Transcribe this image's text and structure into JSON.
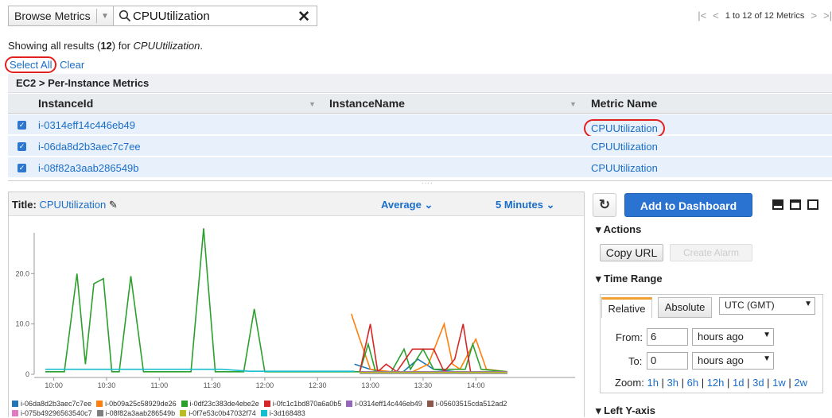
{
  "toolbar": {
    "browse_label": "Browse Metrics",
    "search_value": "CPUUtilization",
    "pager_text": "1 to 12 of 12 Metrics"
  },
  "results": {
    "prefix": "Showing all results (",
    "count": "12",
    "mid": ") for ",
    "query": "CPUUtilization",
    "suffix": ".",
    "select_all": "Select All",
    "clear": "Clear"
  },
  "table": {
    "group_title": "EC2 > Per-Instance Metrics",
    "columns": [
      "InstanceId",
      "InstanceName",
      "Metric Name"
    ],
    "rows": [
      {
        "instance_id": "i-0314eff14c446eb49",
        "metric": "CPUUtilization",
        "checked": true
      },
      {
        "instance_id": "i-06da8d2b3aec7c7ee",
        "metric": "CPUUtilization",
        "checked": true
      },
      {
        "instance_id": "i-08f82a3aab286549b",
        "metric": "CPUUtilization",
        "checked": true
      }
    ]
  },
  "graph": {
    "title_label": "Title:",
    "title_value": "CPUUtilization",
    "statistic": "Average",
    "period": "5 Minutes"
  },
  "chart_data": {
    "type": "line",
    "x": [
      "10:00",
      "10:30",
      "11:00",
      "11:30",
      "12:00",
      "12:30",
      "13:00",
      "13:30",
      "14:00"
    ],
    "ylim": [
      0,
      30
    ],
    "yticks": [
      "0",
      "10.0",
      "20.0"
    ],
    "series": [
      {
        "name": "i-06da8d2b3aec7c7ee",
        "color": "#1f77b4",
        "points": [
          [
            12.85,
            2
          ],
          [
            13.0,
            1
          ],
          [
            13.1,
            0.5
          ],
          [
            13.3,
            0.3
          ],
          [
            13.45,
            3
          ],
          [
            13.6,
            1
          ],
          [
            13.8,
            0.5
          ],
          [
            14.0,
            0.3
          ],
          [
            14.3,
            0.3
          ]
        ]
      },
      {
        "name": "i-0b09a25c58929de26",
        "color": "#ff7f0e",
        "points": [
          [
            12.82,
            12
          ],
          [
            12.9,
            7
          ],
          [
            13.0,
            1
          ],
          [
            13.2,
            0.5
          ],
          [
            13.4,
            0.5
          ],
          [
            13.55,
            2
          ],
          [
            13.7,
            10
          ],
          [
            13.78,
            2
          ],
          [
            13.85,
            1
          ],
          [
            14.0,
            7
          ],
          [
            14.1,
            1
          ],
          [
            14.3,
            0.5
          ]
        ]
      },
      {
        "name": "i-0df23c383de4ebe2e",
        "color": "#2ca02c",
        "points": [
          [
            9.92,
            0.5
          ],
          [
            10.0,
            0.5
          ],
          [
            10.1,
            0.5
          ],
          [
            10.22,
            20
          ],
          [
            10.3,
            2
          ],
          [
            10.38,
            18
          ],
          [
            10.47,
            19
          ],
          [
            10.55,
            0.5
          ],
          [
            10.62,
            0.5
          ],
          [
            10.73,
            19.5
          ],
          [
            10.85,
            0.5
          ],
          [
            11.0,
            0.5
          ],
          [
            11.3,
            0.5
          ],
          [
            11.42,
            29
          ],
          [
            11.53,
            0.5
          ],
          [
            11.8,
            0.5
          ],
          [
            11.9,
            13
          ],
          [
            12.0,
            0.5
          ],
          [
            12.5,
            0.5
          ],
          [
            12.9,
            0.5
          ],
          [
            12.98,
            6
          ],
          [
            13.05,
            0.5
          ],
          [
            13.2,
            0.5
          ],
          [
            13.32,
            5
          ],
          [
            13.38,
            1
          ],
          [
            13.5,
            5
          ],
          [
            13.6,
            1
          ],
          [
            13.7,
            1
          ],
          [
            13.8,
            1
          ],
          [
            13.9,
            1
          ],
          [
            13.97,
            6
          ],
          [
            14.05,
            1
          ],
          [
            14.3,
            0.5
          ]
        ]
      },
      {
        "name": "i-0fc1c1bd870a6a0b5",
        "color": "#d62728",
        "points": [
          [
            12.9,
            0.5
          ],
          [
            13.0,
            10
          ],
          [
            13.07,
            0.5
          ],
          [
            13.15,
            2
          ],
          [
            13.25,
            0.5
          ],
          [
            13.4,
            5
          ],
          [
            13.6,
            5
          ],
          [
            13.7,
            0.5
          ],
          [
            13.8,
            3
          ],
          [
            13.88,
            10
          ],
          [
            13.95,
            0.5
          ],
          [
            14.3,
            0.5
          ]
        ]
      },
      {
        "name": "i-0314eff14c446eb49",
        "color": "#9467bd",
        "points": [
          [
            12.9,
            0.5
          ],
          [
            13.3,
            0.5
          ],
          [
            13.5,
            0.5
          ],
          [
            13.7,
            0.5
          ],
          [
            14.3,
            0.5
          ]
        ]
      },
      {
        "name": "i-05603515cda512ad2",
        "color": "#8c564b",
        "points": [
          [
            12.9,
            0.3
          ],
          [
            13.5,
            0.3
          ],
          [
            14.3,
            0.3
          ]
        ]
      },
      {
        "name": "i-075b49296563540c7",
        "color": "#e377c2",
        "points": [
          [
            12.9,
            0.3
          ],
          [
            14.3,
            0.3
          ]
        ]
      },
      {
        "name": "i-08f82a3aab286549b",
        "color": "#7f7f7f",
        "points": [
          [
            12.9,
            0.2
          ],
          [
            14.3,
            0.2
          ]
        ]
      },
      {
        "name": "i-0f7e53c0b47032f74",
        "color": "#bcbd22",
        "points": [
          [
            12.9,
            0.4
          ],
          [
            14.3,
            0.4
          ]
        ]
      },
      {
        "name": "i-3d168483",
        "color": "#17becf",
        "points": [
          [
            9.92,
            1
          ],
          [
            11.6,
            1
          ],
          [
            11.85,
            0.6
          ],
          [
            12.85,
            0.6
          ]
        ]
      }
    ]
  },
  "side": {
    "refresh_icon": "↻",
    "add_dashboard": "Add to Dashboard",
    "actions_label": "Actions",
    "copy_url": "Copy URL",
    "create_alarm": "Create Alarm",
    "time_range_label": "Time Range",
    "tab_relative": "Relative",
    "tab_absolute": "Absolute",
    "timezone": "UTC (GMT)",
    "from_label": "From:",
    "from_value": "6",
    "from_unit": "hours ago",
    "to_label": "To:",
    "to_value": "0",
    "to_unit": "hours ago",
    "zoom_label": "Zoom:",
    "zoom_options": [
      "1h",
      "3h",
      "6h",
      "12h",
      "1d",
      "3d",
      "1w",
      "2w"
    ],
    "left_y_axis": "Left Y-axis"
  }
}
